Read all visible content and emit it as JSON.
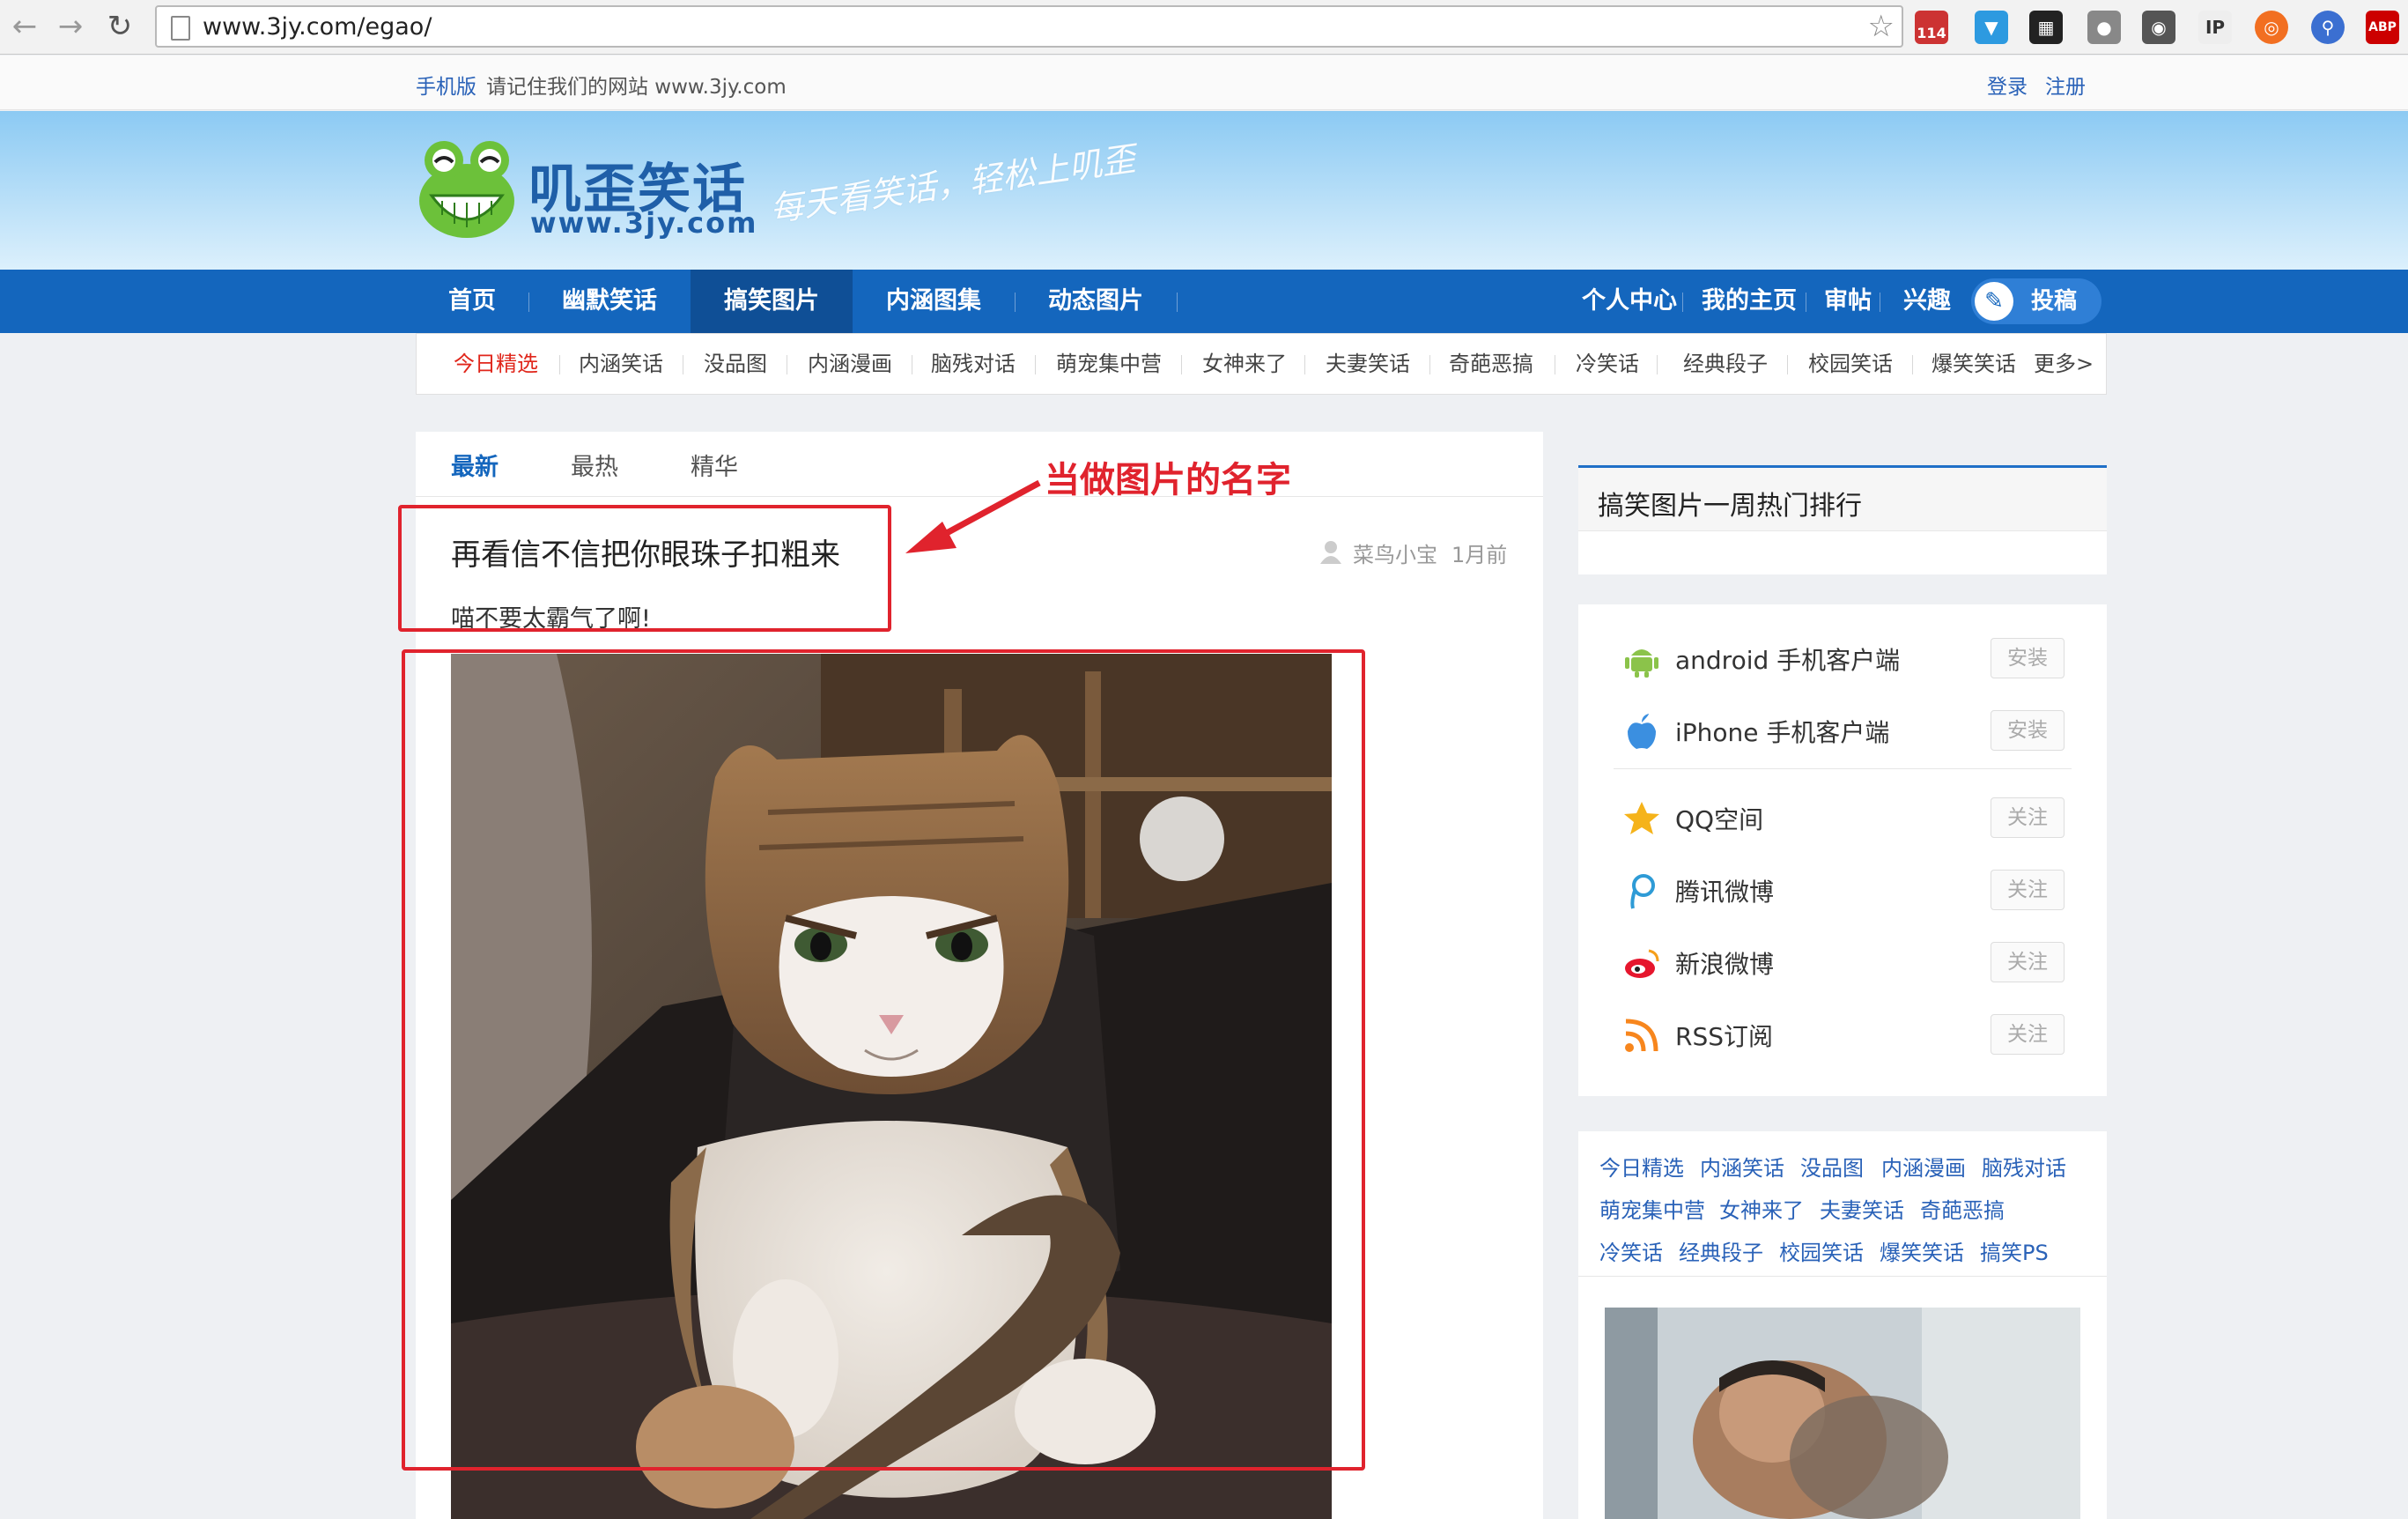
{
  "browser": {
    "url": "www.3jy.com/egao/",
    "extensions": [
      "114",
      "ABP"
    ]
  },
  "topbar": {
    "mobile_link": "手机版",
    "remember_text": "请记住我们的网站 www.3jy.com",
    "login": "登录",
    "register": "注册"
  },
  "header": {
    "logo_title": "叽歪笑话",
    "logo_url": "www.3jy.com",
    "slogan": "每天看笑话，轻松上叽歪"
  },
  "mainnav": {
    "items": [
      "首页",
      "幽默笑话",
      "搞笑图片",
      "内涵图集",
      "动态图片"
    ],
    "active": "搞笑图片",
    "right_items": [
      "个人中心",
      "我的主页",
      "审帖",
      "兴趣"
    ],
    "post_button": "投稿"
  },
  "subnav": {
    "items": [
      "今日精选",
      "内涵笑话",
      "没品图",
      "内涵漫画",
      "脑残对话",
      "萌宠集中营",
      "女神来了",
      "夫妻笑话",
      "奇葩恶搞",
      "冷笑话",
      "经典段子",
      "校园笑话",
      "爆笑笑话",
      "更多>"
    ],
    "active": "今日精选"
  },
  "content": {
    "tabs": [
      "最新",
      "最热",
      "精华"
    ],
    "active_tab": "最新",
    "post": {
      "title": "再看信不信把你眼珠子扣粗来",
      "description": "喵不要太霸气了啊!",
      "author": "菜鸟小宝",
      "time": "1月前"
    },
    "annotation": "当做图片的名字"
  },
  "sidebar": {
    "rank_title": "搞笑图片一周热门排行",
    "apps": [
      {
        "label": "android 手机客户端",
        "button": "安装",
        "icon": "android-icon"
      },
      {
        "label": "iPhone 手机客户端",
        "button": "安装",
        "icon": "apple-icon"
      },
      {
        "label": "QQ空间",
        "button": "关注",
        "icon": "qzone-star-icon"
      },
      {
        "label": "腾讯微博",
        "button": "关注",
        "icon": "tencent-weibo-icon"
      },
      {
        "label": "新浪微博",
        "button": "关注",
        "icon": "sina-weibo-icon"
      },
      {
        "label": "RSS订阅",
        "button": "关注",
        "icon": "rss-icon"
      }
    ],
    "links": [
      "今日精选",
      "内涵笑话",
      "没品图",
      "内涵漫画",
      "脑残对话",
      "萌宠集中营",
      "女神来了",
      "夫妻笑话",
      "奇葩恶搞",
      "冷笑话",
      "经典段子",
      "校园笑话",
      "爆笑笑话",
      "搞笑PS"
    ]
  },
  "colors": {
    "nav_blue": "#1466bd",
    "link_blue": "#2a62b8",
    "annotation_red": "#e0232d",
    "active_red": "#e0261b"
  }
}
